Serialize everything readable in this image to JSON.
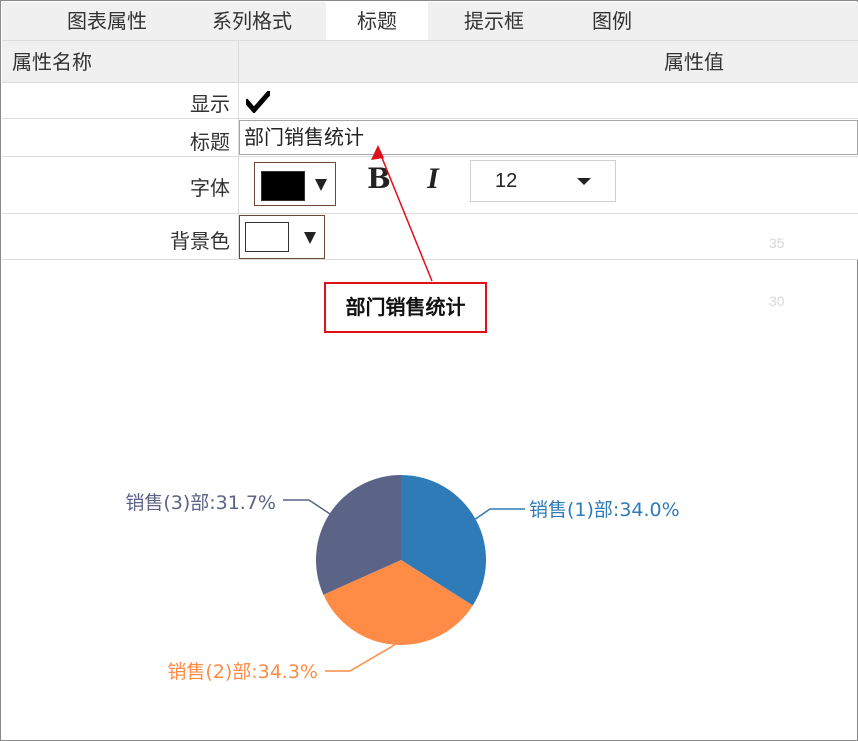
{
  "tabs": [
    {
      "label": "图表属性",
      "active": false
    },
    {
      "label": "系列格式",
      "active": false
    },
    {
      "label": "标题",
      "active": true
    },
    {
      "label": "提示框",
      "active": false
    },
    {
      "label": "图例",
      "active": false
    }
  ],
  "grid": {
    "header_name": "属性名称",
    "header_value": "属性值",
    "rows": {
      "show": {
        "label": "显示",
        "checked": true
      },
      "title": {
        "label": "标题",
        "value": "部门销售统计"
      },
      "font": {
        "label": "字体",
        "color": "#000000",
        "bold_label": "B",
        "italic_label": "I",
        "size": "12"
      },
      "background": {
        "label": "背景色",
        "color": "#ffffff"
      }
    }
  },
  "callout": {
    "text": "部门销售统计",
    "border_color": "#e0101a"
  },
  "faint_ticks": [
    "35",
    "30"
  ],
  "chart_data": {
    "type": "pie",
    "title": "",
    "slices": [
      {
        "label": "销售(1)部:34.0%",
        "name": "销售(1)部",
        "value": 34.0,
        "color": "#2e7bb8"
      },
      {
        "label": "销售(2)部:34.3%",
        "name": "销售(2)部",
        "value": 34.3,
        "color": "#ff8c46"
      },
      {
        "label": "销售(3)部:31.7%",
        "name": "销售(3)部",
        "value": 31.7,
        "color": "#5b6386"
      }
    ]
  }
}
